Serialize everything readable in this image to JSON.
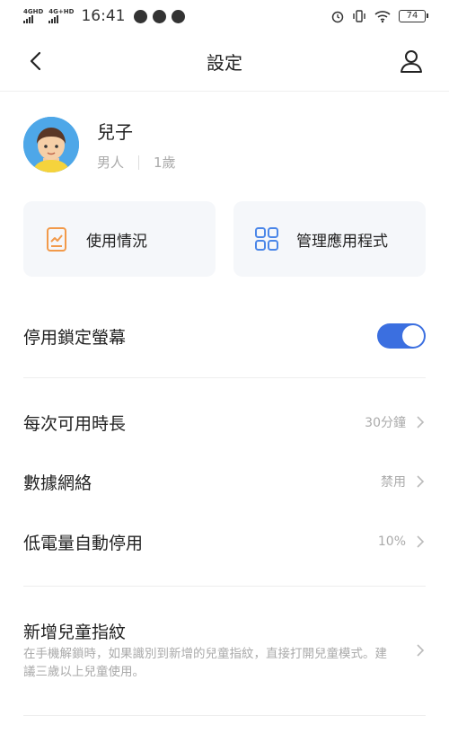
{
  "status_bar": {
    "network1": "4GHD",
    "network2": "4G+HD",
    "time": "16:41",
    "battery": "74"
  },
  "nav": {
    "title": "設定"
  },
  "profile": {
    "name": "兒子",
    "gender": "男人",
    "age": "1歲"
  },
  "cards": {
    "usage_label": "使用情況",
    "apps_label": "管理應用程式"
  },
  "settings": {
    "lock_screen_label": "停用鎖定螢幕",
    "lock_screen_enabled": true,
    "time_limit_label": "每次可用時長",
    "time_limit_value": "30分鐘",
    "data_network_label": "數據網絡",
    "data_network_value": "禁用",
    "low_battery_label": "低電量自動停用",
    "low_battery_value": "10%",
    "fingerprint_label": "新增兒童指紋",
    "fingerprint_desc": "在手機解鎖時，如果識別到新增的兒童指紋，直接打開兒童模式。建議三歲以上兒童使用。"
  },
  "colors": {
    "accent": "#3b6fe0",
    "card_bg": "#f5f7fa",
    "usage_icon": "#f29a4a",
    "apps_icon": "#4a86e8"
  }
}
